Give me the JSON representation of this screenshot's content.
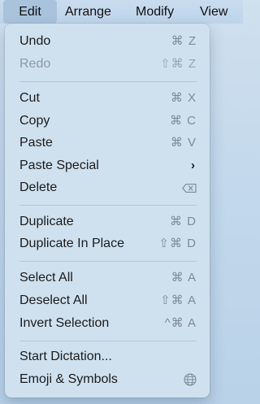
{
  "menubar": {
    "items": [
      "Edit",
      "Arrange",
      "Modify",
      "View"
    ]
  },
  "menu": {
    "undo": {
      "label": "Undo",
      "shortcut": "⌘ Z"
    },
    "redo": {
      "label": "Redo",
      "shortcut": "⇧⌘ Z"
    },
    "cut": {
      "label": "Cut",
      "shortcut": "⌘ X"
    },
    "copy": {
      "label": "Copy",
      "shortcut": "⌘ C"
    },
    "paste": {
      "label": "Paste",
      "shortcut": "⌘ V"
    },
    "paste_special": {
      "label": "Paste Special",
      "submenu_icon": "chevron-right-icon"
    },
    "delete": {
      "label": "Delete",
      "icon": "delete-backward-icon"
    },
    "duplicate": {
      "label": "Duplicate",
      "shortcut": "⌘ D"
    },
    "duplicate_in_place": {
      "label": "Duplicate In Place",
      "shortcut": "⇧⌘ D"
    },
    "select_all": {
      "label": "Select All",
      "shortcut": "⌘ A"
    },
    "deselect_all": {
      "label": "Deselect All",
      "shortcut": "⇧⌘ A"
    },
    "invert_selection": {
      "label": "Invert Selection",
      "shortcut": "^⌘ A"
    },
    "start_dictation": {
      "label": "Start Dictation..."
    },
    "emoji_symbols": {
      "label": "Emoji & Symbols",
      "icon": "globe-icon"
    }
  }
}
